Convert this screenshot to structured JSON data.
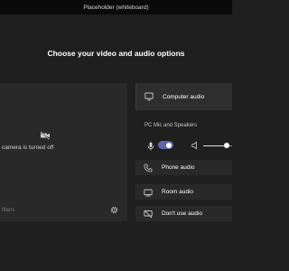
{
  "window": {
    "title": "Placeholder (whiteboard)"
  },
  "heading": "Choose your video and audio options",
  "video": {
    "camera_status": "camera is turned off",
    "filters_label": "filters"
  },
  "audio": {
    "computer_audio_label": "Computer audio",
    "device_label": "PC Mic and Speakers",
    "mic_on": true,
    "volume_level": 0.82,
    "phone_audio_label": "Phone audio",
    "room_audio_label": "Room audio",
    "no_audio_label": "Don't use audio"
  },
  "colors": {
    "accent": "#6264a7",
    "background": "#1f1f1f",
    "panel": "#292929"
  }
}
